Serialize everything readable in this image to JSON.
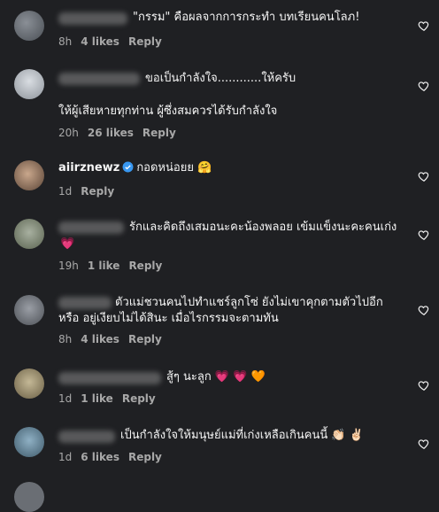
{
  "comments": [
    {
      "text": "\"กรรม\" คือผลจากการกระทำ บทเรียนคนโลภ!",
      "time": "8h",
      "likes": "4 likes",
      "reply": "Reply"
    },
    {
      "text1": "ขอเป็นกำลังใจ............ให้ครับ",
      "text2": "ให้ผู้เสียหายทุกท่าน ผู้ซึ่งสมควรได้รับกำลังใจ",
      "time": "20h",
      "likes": "26 likes",
      "reply": "Reply"
    },
    {
      "username": "aiirznewz",
      "text": "กอดหน่อยย",
      "emoji": "🤗",
      "time": "1d",
      "reply": "Reply"
    },
    {
      "text1": "รักและคิดถึงเสมอนะคะน้องพลอย เข้มแข็งนะคะคนเก่ง",
      "text2_emoji": "💗",
      "time": "19h",
      "likes": "1 like",
      "reply": "Reply"
    },
    {
      "text1": "ตัวแม่ชวนคนไปทำแชร์ลูกโซ่ ยังไม่เขาคุกตามตัวไปอีก",
      "text2": "หรือ อยู่เงียบไม่ได้สินะ เมื่อไรกรรมจะตามทัน",
      "time": "8h",
      "likes": "4 likes",
      "reply": "Reply"
    },
    {
      "text": "สู้ๆ นะลูก",
      "emoji": "💗 💗 🧡",
      "time": "1d",
      "likes": "1 like",
      "reply": "Reply"
    },
    {
      "text": "เป็นกำลังใจให้มนุษย์แม่ที่เก่งเหลือเกินคนนี้",
      "emoji": "👏🏻 ✌🏻",
      "time": "1d",
      "likes": "6 likes",
      "reply": "Reply"
    }
  ],
  "colors": {
    "background": "#1f2023",
    "meta": "#a8a8a8",
    "verified": "#3897f0"
  }
}
